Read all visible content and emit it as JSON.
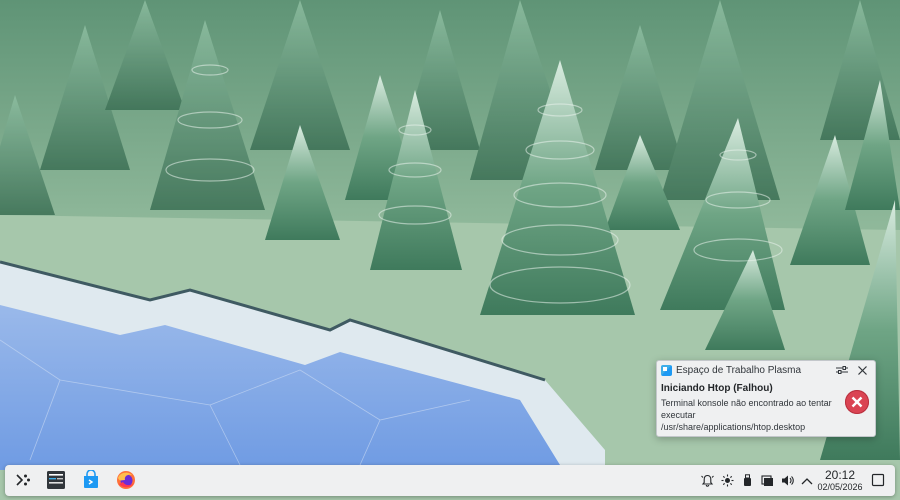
{
  "notification": {
    "app_name": "Espaço de Trabalho Plasma",
    "title": "Iniciando Htop (Falhou)",
    "message": "Terminal konsole não encontrado ao tentar executar /usr/share/applications/htop.desktop",
    "icon": "dialog-error-icon",
    "error_color": "#da4453"
  },
  "panel": {
    "launchers": [
      {
        "name": "application-launcher",
        "icon": "kde-launcher-icon"
      },
      {
        "name": "system-monitor",
        "icon": "system-monitor-icon"
      },
      {
        "name": "discover",
        "icon": "discover-store-icon"
      },
      {
        "name": "firefox",
        "icon": "firefox-icon"
      }
    ],
    "tray": [
      "notifications-bell-icon",
      "brightness-icon",
      "usb-device-icon",
      "clipboard-icon",
      "volume-icon",
      "expand-tray-chevron-icon"
    ],
    "clock": {
      "time": "20:12",
      "date": "02/05/2026"
    }
  },
  "colors": {
    "panel_bg": "#eff0f1",
    "accent": "#3daee9"
  }
}
